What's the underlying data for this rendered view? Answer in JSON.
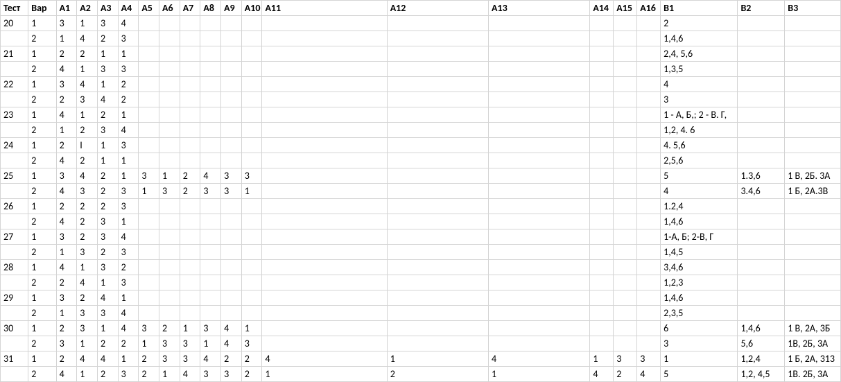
{
  "headers": [
    "Тест",
    "Вар",
    "A1",
    "A2",
    "A3",
    "A4",
    "A5",
    "A6",
    "A7",
    "A8",
    "A9",
    "A10",
    "A11",
    "A12",
    "A13",
    "A14",
    "A15",
    "A16",
    "B1",
    "B2",
    "B3"
  ],
  "rows": [
    {
      "test": "20",
      "var": "1",
      "a": [
        "3",
        "1",
        "3",
        "4",
        "",
        "",
        "",
        "",
        "",
        "",
        "",
        "",
        "",
        "",
        "",
        ""
      ],
      "b": [
        "2",
        "",
        ""
      ]
    },
    {
      "test": "",
      "var": "2",
      "a": [
        "1",
        "4",
        "2",
        "3",
        "",
        "",
        "",
        "",
        "",
        "",
        "",
        "",
        "",
        "",
        "",
        ""
      ],
      "b": [
        "1,4,6",
        "",
        ""
      ]
    },
    {
      "test": "21",
      "var": "1",
      "a": [
        "2",
        "2",
        "1",
        "1",
        "",
        "",
        "",
        "",
        "",
        "",
        "",
        "",
        "",
        "",
        "",
        ""
      ],
      "b": [
        "2,4, 5,6",
        "",
        ""
      ]
    },
    {
      "test": "",
      "var": "2",
      "a": [
        "4",
        "1",
        "3",
        "3",
        "",
        "",
        "",
        "",
        "",
        "",
        "",
        "",
        "",
        "",
        "",
        ""
      ],
      "b": [
        "1,3,5",
        "",
        ""
      ]
    },
    {
      "test": "22",
      "var": "1",
      "a": [
        "3",
        "4",
        "1",
        "2",
        "",
        "",
        "",
        "",
        "",
        "",
        "",
        "",
        "",
        "",
        "",
        ""
      ],
      "b": [
        "4",
        "",
        ""
      ]
    },
    {
      "test": "",
      "var": "2",
      "a": [
        "2",
        "3",
        "4",
        "2",
        "",
        "",
        "",
        "",
        "",
        "",
        "",
        "",
        "",
        "",
        "",
        ""
      ],
      "b": [
        "3",
        "",
        ""
      ]
    },
    {
      "test": "23",
      "var": "1",
      "a": [
        "4",
        "1",
        "2",
        "1",
        "",
        "",
        "",
        "",
        "",
        "",
        "",
        "",
        "",
        "",
        "",
        ""
      ],
      "b": [
        "1 - А, Б,; 2  - В. Г,",
        "",
        ""
      ]
    },
    {
      "test": "",
      "var": "2",
      "a": [
        "1",
        "2",
        "3",
        "4",
        "",
        "",
        "",
        "",
        "",
        "",
        "",
        "",
        "",
        "",
        "",
        ""
      ],
      "b": [
        "1,2, 4. 6",
        "",
        ""
      ]
    },
    {
      "test": "24",
      "var": "1",
      "a": [
        "2",
        "I",
        "1",
        "3",
        "",
        "",
        "",
        "",
        "",
        "",
        "",
        "",
        "",
        "",
        "",
        ""
      ],
      "b": [
        "4. 5,6",
        "",
        ""
      ]
    },
    {
      "test": "",
      "var": "2",
      "a": [
        "4",
        "2",
        "1",
        "1",
        "",
        "",
        "",
        "",
        "",
        "",
        "",
        "",
        "",
        "",
        "",
        ""
      ],
      "b": [
        "2,5,6",
        "",
        ""
      ]
    },
    {
      "test": "25",
      "var": "1",
      "a": [
        "3",
        "4",
        "2",
        "1",
        "3",
        "1",
        "2",
        "4",
        "3",
        "3",
        "",
        "",
        "",
        "",
        "",
        ""
      ],
      "b": [
        "5",
        "1.3,6",
        "1 В, 2Б. 3А"
      ]
    },
    {
      "test": "",
      "var": "2",
      "a": [
        "4",
        "3",
        "2",
        "3",
        "1",
        "3",
        "2",
        "3",
        "3",
        "1",
        "",
        "",
        "",
        "",
        "",
        ""
      ],
      "b": [
        "4",
        "3.4,6",
        "1 Б, 2А.3В"
      ]
    },
    {
      "test": "26",
      "var": "1",
      "a": [
        "2",
        "2",
        "2",
        "3",
        "",
        "",
        "",
        "",
        "",
        "",
        "",
        "",
        "",
        "",
        "",
        ""
      ],
      "b": [
        "1.2,4",
        "",
        ""
      ]
    },
    {
      "test": "",
      "var": "2",
      "a": [
        "4",
        "2",
        "3",
        "1",
        "",
        "",
        "",
        "",
        "",
        "",
        "",
        "",
        "",
        "",
        "",
        ""
      ],
      "b": [
        "1,4,6",
        "",
        ""
      ]
    },
    {
      "test": "27",
      "var": "1",
      "a": [
        "3",
        "2",
        "3",
        "4",
        "",
        "",
        "",
        "",
        "",
        "",
        "",
        "",
        "",
        "",
        "",
        ""
      ],
      "b": [
        "1-А, Б; 2-В, Г",
        "",
        ""
      ]
    },
    {
      "test": "",
      "var": "2",
      "a": [
        "1",
        "3",
        "2",
        "3",
        "",
        "",
        "",
        "",
        "",
        "",
        "",
        "",
        "",
        "",
        "",
        ""
      ],
      "b": [
        "1,4,5",
        "",
        ""
      ]
    },
    {
      "test": "28",
      "var": "1",
      "a": [
        "4",
        "1",
        "3",
        "2",
        "",
        "",
        "",
        "",
        "",
        "",
        "",
        "",
        "",
        "",
        "",
        ""
      ],
      "b": [
        "3,4,6",
        "",
        ""
      ]
    },
    {
      "test": "",
      "var": "2",
      "a": [
        "2",
        "4",
        "1",
        "3",
        "",
        "",
        "",
        "",
        "",
        "",
        "",
        "",
        "",
        "",
        "",
        ""
      ],
      "b": [
        "1,2,3",
        "",
        ""
      ]
    },
    {
      "test": "29",
      "var": "1",
      "a": [
        "3",
        "2",
        "4",
        "1",
        "",
        "",
        "",
        "",
        "",
        "",
        "",
        "",
        "",
        "",
        "",
        ""
      ],
      "b": [
        "1,4,6",
        "",
        ""
      ]
    },
    {
      "test": "",
      "var": "2",
      "a": [
        "1",
        "3",
        "3",
        "4",
        "",
        "",
        "",
        "",
        "",
        "",
        "",
        "",
        "",
        "",
        "",
        ""
      ],
      "b": [
        "2,3,5",
        "",
        ""
      ]
    },
    {
      "test": "30",
      "var": "1",
      "a": [
        "2",
        "3",
        "1",
        "4",
        "3",
        "2",
        "1",
        "3",
        "4",
        "1",
        "",
        "",
        "",
        "",
        "",
        ""
      ],
      "b": [
        "6",
        "1,4,6",
        "1 В, 2А, 3Б"
      ]
    },
    {
      "test": "",
      "var": "2",
      "a": [
        "3",
        "1",
        "2",
        "2",
        "1",
        "3",
        "3",
        "1",
        "4",
        "3",
        "",
        "",
        "",
        "",
        "",
        ""
      ],
      "b": [
        "3",
        "5,6",
        "1В, 2Б, 3А"
      ]
    },
    {
      "test": "31",
      "var": "1",
      "a": [
        "2",
        "4",
        "4",
        "1",
        "2",
        "3",
        "3",
        "4",
        "2",
        "2",
        "4",
        "1",
        "4",
        "1",
        "3",
        "3"
      ],
      "b": [
        "1",
        "1,2,4",
        "1 Б, 2А, 313"
      ]
    },
    {
      "test": "",
      "var": "2",
      "a": [
        "4",
        "1",
        "2",
        "3",
        "2",
        "1",
        "4",
        "3",
        "3",
        "2",
        "1",
        "2",
        "1",
        "4",
        "2",
        "4"
      ],
      "b": [
        "5",
        "1,2, 4,5",
        "1В. 2Б, 3А"
      ]
    }
  ]
}
